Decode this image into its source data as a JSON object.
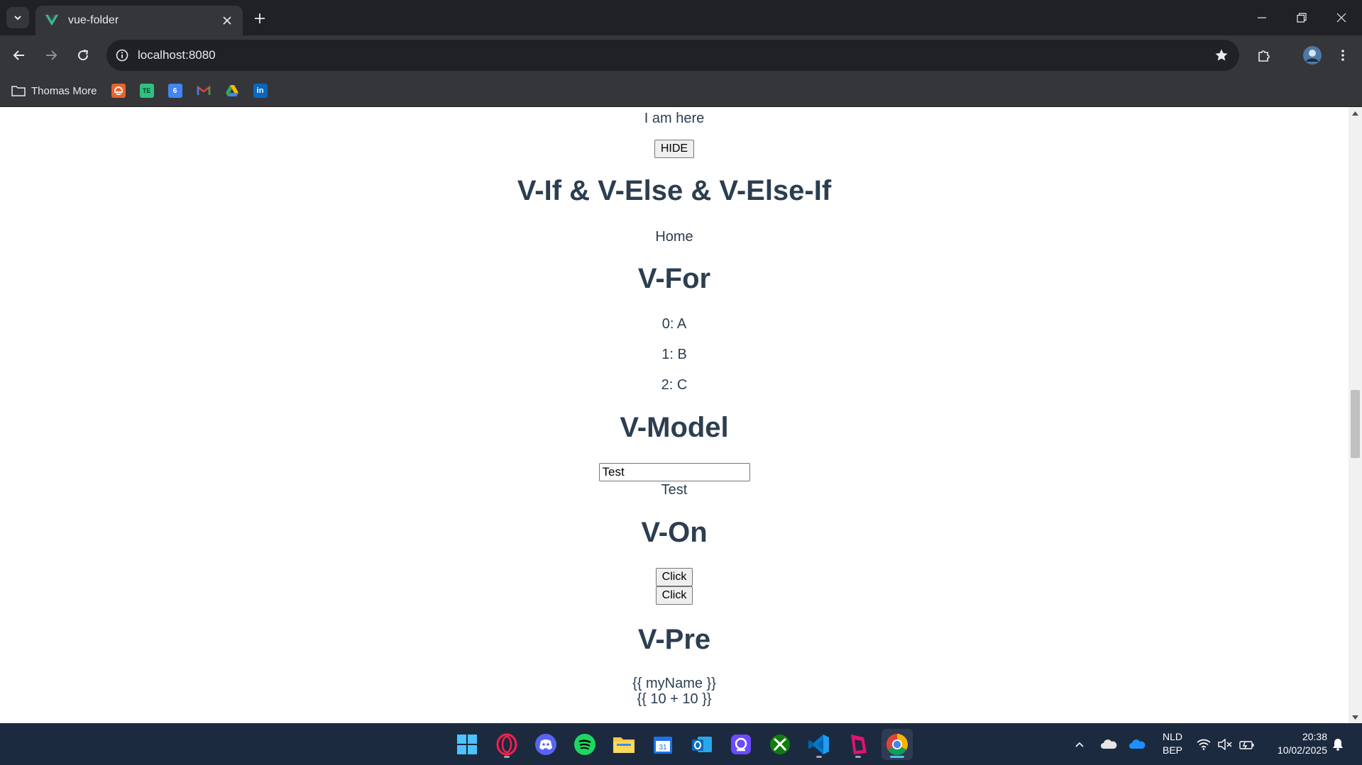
{
  "browser": {
    "tab_title": "vue-folder",
    "url": "localhost:8080",
    "bookmarks": {
      "folder_label": "Thomas More",
      "icons": [
        "brand-orange-icon",
        "te-icon",
        "google-calendar-icon",
        "gmail-icon",
        "google-drive-icon",
        "linkedin-icon"
      ]
    }
  },
  "page": {
    "visible_text": "I am here",
    "hide_button": "HIDE",
    "heading_vif": "V-If & V-Else & V-Else-If",
    "vif_result": "Home",
    "heading_vfor": "V-For",
    "vfor_items": [
      "0: A",
      "1: B",
      "2: C"
    ],
    "heading_vmodel": "V-Model",
    "vmodel_input_value": "Test",
    "vmodel_output": "Test",
    "heading_von": "V-On",
    "click_button_1": "Click",
    "click_button_2": "Click",
    "heading_vpre": "V-Pre",
    "vpre_line_1": "{{ myName }}",
    "vpre_line_2": "{{ 10 + 10 }}"
  },
  "taskbar": {
    "apps": [
      "windows-start-icon",
      "opera-gx-icon",
      "discord-icon",
      "spotify-icon",
      "file-explorer-icon",
      "calendar-icon",
      "outlook-icon",
      "proton-icon",
      "xbox-icon",
      "vscode-icon",
      "app-icon",
      "chrome-icon"
    ],
    "language": "NLD",
    "layout": "BEP",
    "time": "20:38",
    "date": "10/02/2025"
  },
  "colors": {
    "text": "#2c3e50",
    "tabstrip": "#202124",
    "toolbar": "#35363a",
    "taskbar": "#1c2a3f"
  }
}
